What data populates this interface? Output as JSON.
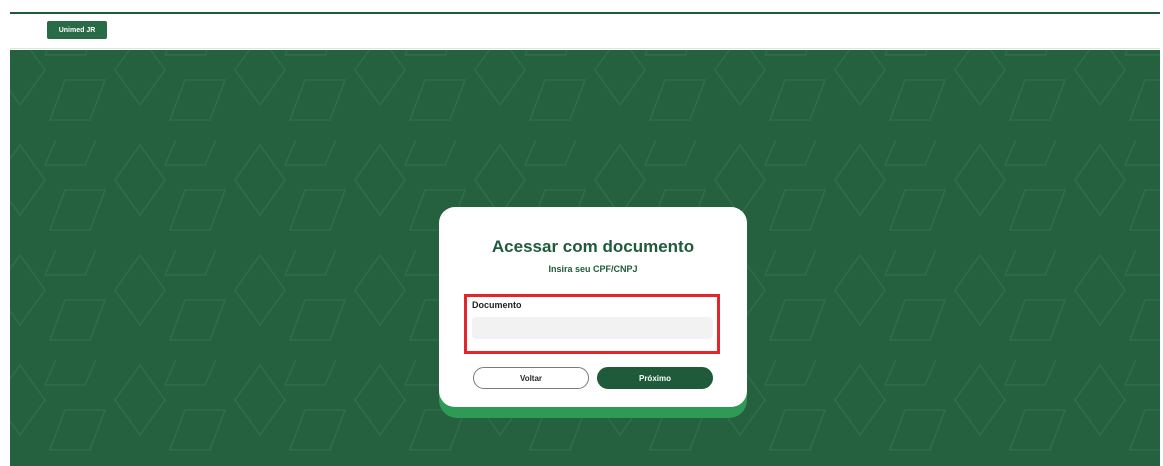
{
  "header": {
    "logo_text": "Unimed JR"
  },
  "login": {
    "title": "Acessar com documento",
    "subtitle": "Insira seu CPF/CNPJ",
    "document_label": "Documento",
    "document_value": "",
    "back_label": "Voltar",
    "next_label": "Próximo"
  },
  "colors": {
    "brand_green": "#1f5a3b",
    "background_green": "#25603f",
    "accent_green": "#2f9a55",
    "highlight_red": "#e3262b"
  }
}
